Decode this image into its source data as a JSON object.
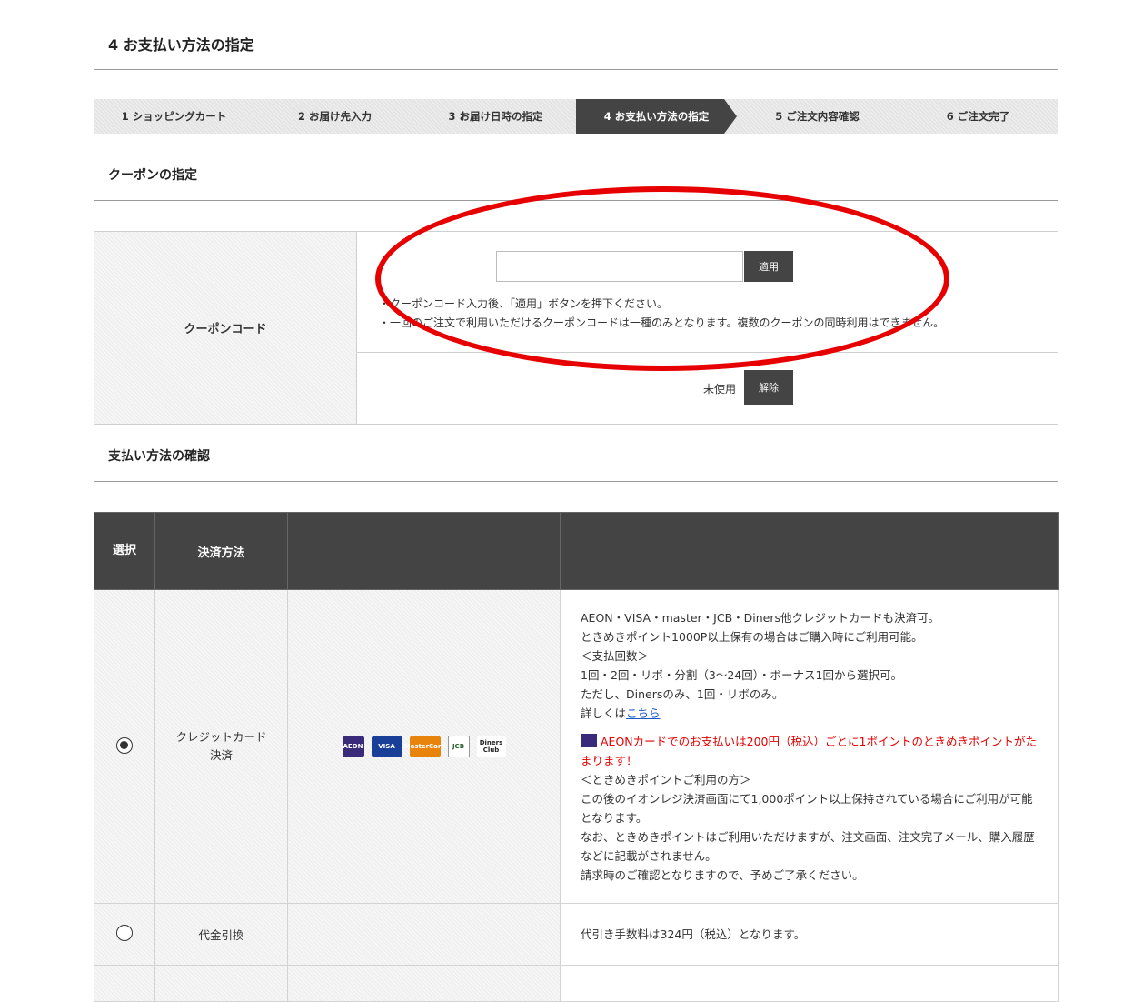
{
  "page_title": "4 お支払い方法の指定",
  "steps": [
    "1 ショッピングカート",
    "2 お届け先入力",
    "3 お届け日時の指定",
    "4 お支払い方法の指定",
    "5 ご注文内容確認",
    "6 ご注文完了"
  ],
  "active_step": 3,
  "coupon_section": {
    "title": "クーポンの指定",
    "label": "クーポンコード",
    "input_value": "",
    "apply_label": "適用",
    "note1": "・クーポンコード入力後、「適用」ボタンを押下ください。",
    "note2": "・一回のご注文で利用いただけるクーポンコードは一種のみとなります。複数のクーポンの同時利用はできません。",
    "status": "未使用",
    "cancel_label": "解除"
  },
  "payment_section": {
    "title": "支払い方法の確認",
    "headers": {
      "select": "選択",
      "method": "決済方法",
      "logos": "",
      "details": ""
    },
    "credit": {
      "name": "クレジットカード決済",
      "logos": [
        "AEON",
        "VISA",
        "MasterCard",
        "JCB",
        "Diners Club"
      ],
      "line1": "AEON・VISA・master・JCB・Diners他クレジットカードも決済可。",
      "line2": "ときめきポイント1000P以上保有の場合はご購入時にご利用可能。",
      "line3": "＜支払回数＞",
      "line4": "1回・2回・リボ・分割（3〜24回）・ボーナス1回から選択可。",
      "line5": "ただし、Dinersのみ、1回・リボのみ。",
      "line6_prefix": "詳しくは",
      "line6_link": "こちら",
      "promo": "AEONカードでのお支払いは200円（税込）ごとに1ポイントのときめきポイントがたまります！",
      "line8": "＜ときめきポイントご利用の方＞",
      "line9": "この後のイオンレジ決済画面にて1,000ポイント以上保持されている場合にご利用が可能となります。",
      "line10": "なお、ときめきポイントはご利用いただけますが、注文画面、注文完了メール、購入履歴などに記載がされません。",
      "line11": "請求時のご確認となりますので、予めご了承ください。"
    },
    "cod": {
      "name": "代金引換",
      "details": "代引き手数料は324円（税込）となります。"
    }
  },
  "colors": {
    "header_bg": "#444444",
    "accent_red": "#e60000",
    "link": "#1a55c9"
  }
}
